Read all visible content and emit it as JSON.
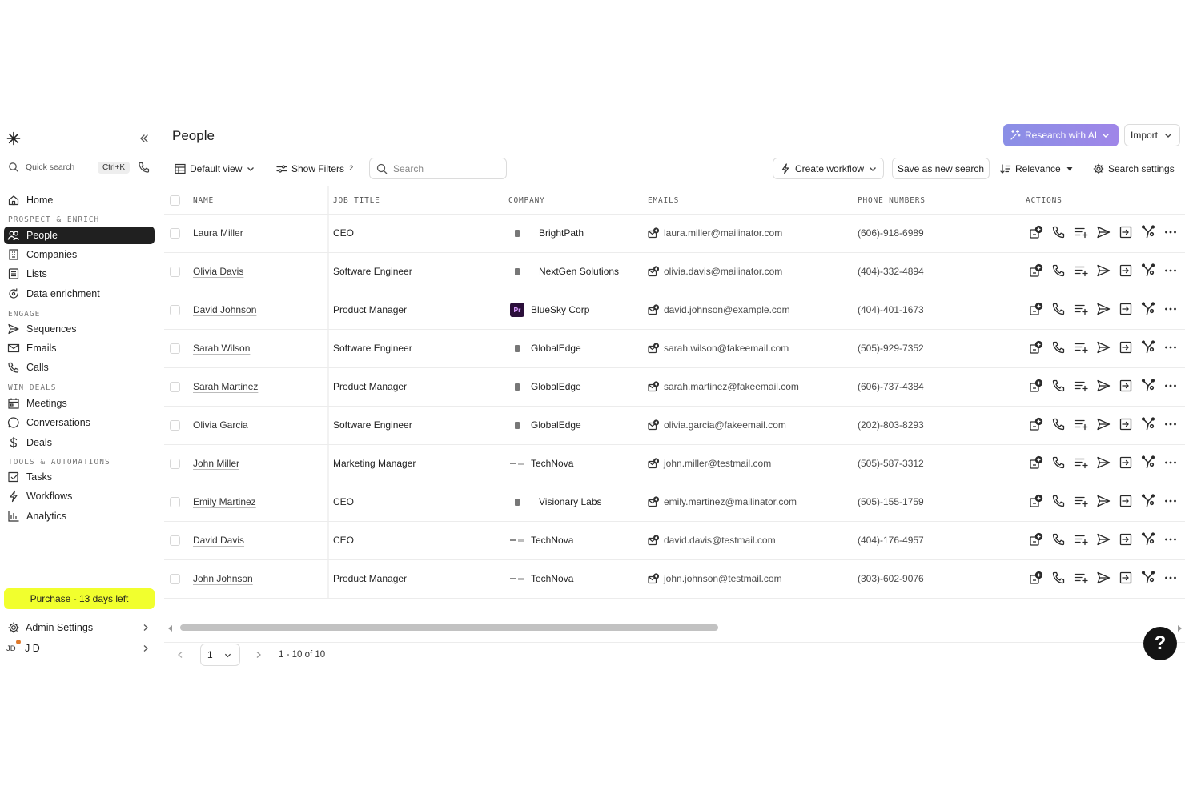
{
  "sidebar": {
    "quick_search_label": "Quick search",
    "quick_search_shortcut": "Ctrl+K",
    "home_label": "Home",
    "sections": [
      {
        "title": "PROSPECT & ENRICH",
        "items": [
          "People",
          "Companies",
          "Lists",
          "Data enrichment"
        ]
      },
      {
        "title": "ENGAGE",
        "items": [
          "Sequences",
          "Emails",
          "Calls"
        ]
      },
      {
        "title": "WIN DEALS",
        "items": [
          "Meetings",
          "Conversations",
          "Deals"
        ]
      },
      {
        "title": "TOOLS & AUTOMATIONS",
        "items": [
          "Tasks",
          "Workflows",
          "Analytics"
        ]
      }
    ],
    "active_item": "People",
    "purchase_label": "Purchase - 13 days left",
    "admin_label": "Admin Settings",
    "user_initials": "JD",
    "user_name": "J D"
  },
  "header": {
    "title": "People",
    "research_ai_label": "Research with AI",
    "import_label": "Import"
  },
  "toolbar": {
    "default_view_label": "Default view",
    "show_filters_label": "Show Filters",
    "filters_count": "2",
    "search_placeholder": "Search",
    "create_workflow_label": "Create workflow",
    "save_search_label": "Save as new search",
    "relevance_label": "Relevance",
    "search_settings_label": "Search settings"
  },
  "table": {
    "columns": [
      "NAME",
      "JOB TITLE",
      "COMPANY",
      "EMAILS",
      "PHONE NUMBERS",
      "ACTIONS"
    ],
    "rows": [
      {
        "name": "Laura Miller",
        "title": "CEO",
        "company": "BrightPath",
        "logo": "building",
        "email": "laura.miller@mailinator.com",
        "phone": "(606)-918-6989"
      },
      {
        "name": "Olivia Davis",
        "title": "Software Engineer",
        "company": "NextGen Solutions",
        "logo": "building",
        "email": "olivia.davis@mailinator.com",
        "phone": "(404)-332-4894"
      },
      {
        "name": "David Johnson",
        "title": "Product Manager",
        "company": "BlueSky Corp",
        "logo": "pr",
        "email": "david.johnson@example.com",
        "phone": "(404)-401-1673"
      },
      {
        "name": "Sarah Wilson",
        "title": "Software Engineer",
        "company": "GlobalEdge",
        "logo": "building",
        "email": "sarah.wilson@fakeemail.com",
        "phone": "(505)-929-7352"
      },
      {
        "name": "Sarah Martinez",
        "title": "Product Manager",
        "company": "GlobalEdge",
        "logo": "building",
        "email": "sarah.martinez@fakeemail.com",
        "phone": "(606)-737-4384"
      },
      {
        "name": "Olivia Garcia",
        "title": "Software Engineer",
        "company": "GlobalEdge",
        "logo": "building",
        "email": "olivia.garcia@fakeemail.com",
        "phone": "(202)-803-8293"
      },
      {
        "name": "John Miller",
        "title": "Marketing Manager",
        "company": "TechNova",
        "logo": "technova",
        "email": "john.miller@testmail.com",
        "phone": "(505)-587-3312"
      },
      {
        "name": "Emily Martinez",
        "title": "CEO",
        "company": "Visionary Labs",
        "logo": "building",
        "email": "emily.martinez@mailinator.com",
        "phone": "(505)-155-1759"
      },
      {
        "name": "David Davis",
        "title": "CEO",
        "company": "TechNova",
        "logo": "technova",
        "email": "david.davis@testmail.com",
        "phone": "(404)-176-4957"
      },
      {
        "name": "John Johnson",
        "title": "Product Manager",
        "company": "TechNova",
        "logo": "technova",
        "email": "john.johnson@testmail.com",
        "phone": "(303)-602-9076"
      }
    ],
    "row_actions": [
      "enrich-icon",
      "phone-icon",
      "add-to-list-icon",
      "send-icon",
      "export-icon",
      "workflow-icon",
      "more-icon"
    ]
  },
  "pagination": {
    "current_page": "1",
    "range_label": "1 - 10 of 10"
  },
  "help_label": "?",
  "colors": {
    "accent_purchase": "#f1ff2e",
    "ai_gradient_start": "#8a8fe6",
    "ai_gradient_end": "#9f86e8",
    "active_nav": "#202020"
  }
}
